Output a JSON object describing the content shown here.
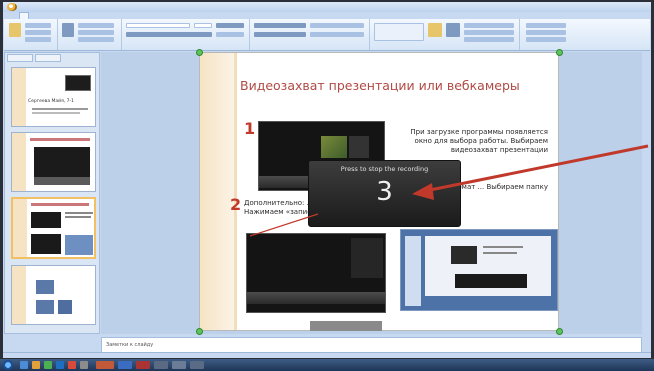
{
  "window": {
    "title": "",
    "ribbon_tabs": [
      "",
      "",
      "",
      "",
      "",
      "",
      "",
      ""
    ]
  },
  "slides_pane": {
    "tabs": [
      "",
      ""
    ],
    "thumb1_title": "Сергеева Майя, 7-1",
    "thumb1_caption": ""
  },
  "slide": {
    "title": "Видеозахват презентации или вебкамеры",
    "marker1": "1",
    "marker2": "2",
    "right_text": "При загрузке программы появляется окно для выбора работы. Выбираем видеозахват презентации",
    "right_text2": "... записи. Формат ... Выбираем папку",
    "left_text": "Дополнительно: ... Нажимаем «запись»"
  },
  "overlay": {
    "prefix": "Press",
    "key": "",
    "suffix": "to stop the recording",
    "countdown": "3"
  },
  "notes": {
    "text": "Заметки к слайду"
  },
  "status": {
    "text": ""
  },
  "taskbar": {
    "clock": ""
  },
  "colors": {
    "accent_title": "#b04a44",
    "marker_red": "#c0392b",
    "handle_green": "#5ec35e",
    "arrow_red": "#c0392b"
  }
}
